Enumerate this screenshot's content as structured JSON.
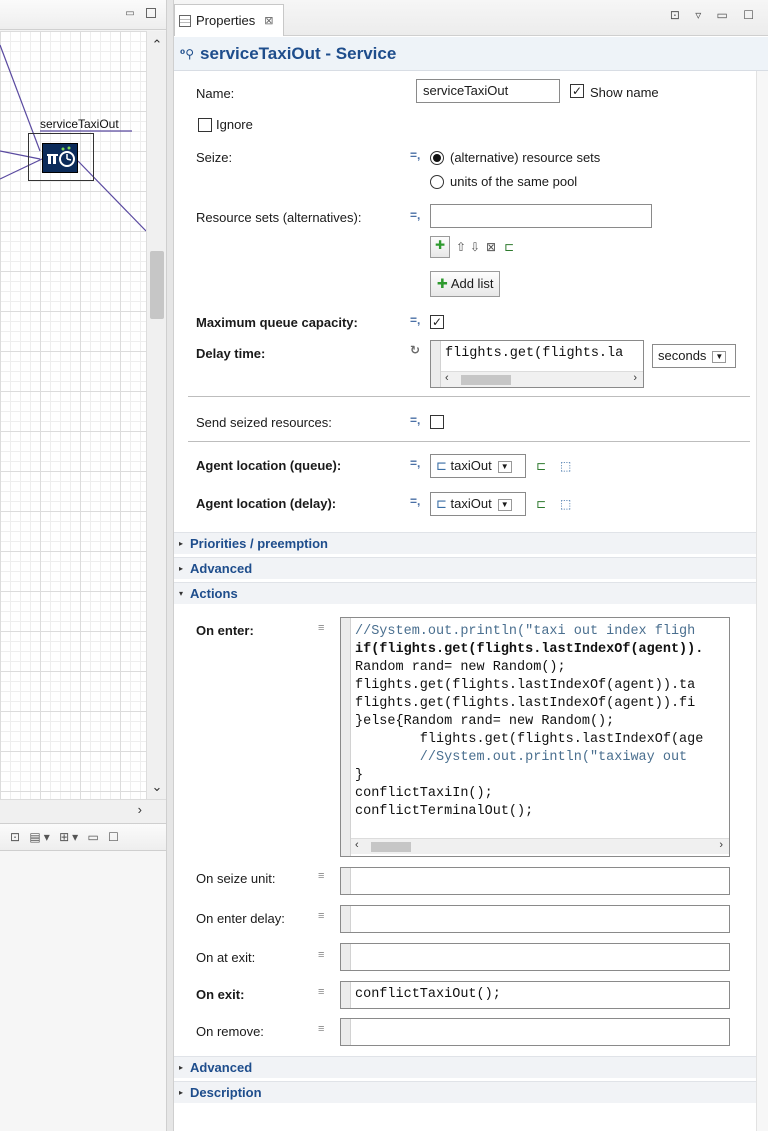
{
  "diagram": {
    "agent_label": "serviceTaxiOut",
    "agent_icon_glyph": "⌚"
  },
  "properties_tab": {
    "title": "Properties",
    "close_glyph": "⊠"
  },
  "header": {
    "icon_glyph": "ᴮᵃ",
    "title": "serviceTaxiOut - Service"
  },
  "fields": {
    "name_label": "Name:",
    "name_value": "serviceTaxiOut",
    "show_name_label": "Show name",
    "ignore_label": "Ignore",
    "seize_label": "Seize:",
    "seize_option_1": "(alternative) resource sets",
    "seize_option_2": "units of the same pool",
    "resource_sets_label": "Resource sets (alternatives):",
    "add_list_label": "Add list",
    "max_queue_label": "Maximum queue capacity:",
    "delay_time_label": "Delay time:",
    "delay_time_value": "flights.get(flights.la",
    "delay_unit": "seconds",
    "send_seized_label": "Send seized resources:",
    "loc_queue_label": "Agent location (queue):",
    "loc_queue_value": "taxiOut",
    "loc_delay_label": "Agent location (delay):",
    "loc_delay_value": "taxiOut"
  },
  "sections": {
    "priorities": "Priorities / preemption",
    "advanced_1": "Advanced",
    "actions": "Actions",
    "advanced_2": "Advanced",
    "description": "Description"
  },
  "actions": {
    "on_enter_label": "On enter:",
    "on_enter_code": [
      "//System.out.println(\"taxi out index fligh",
      "if(flights.get(flights.lastIndexOf(agent)).",
      "Random rand= new Random();",
      "flights.get(flights.lastIndexOf(agent)).ta",
      "flights.get(flights.lastIndexOf(agent)).fi",
      "}else{Random rand= new Random();",
      "        flights.get(flights.lastIndexOf(age",
      "        //System.out.println(\"taxiway out ",
      "}",
      "conflictTaxiIn();",
      "conflictTerminalOut();"
    ],
    "on_seize_unit_label": "On seize unit:",
    "on_enter_delay_label": "On enter delay:",
    "on_at_exit_label": "On at exit:",
    "on_exit_label": "On exit:",
    "on_exit_code": "conflictTaxiOut();",
    "on_remove_label": "On remove:"
  }
}
